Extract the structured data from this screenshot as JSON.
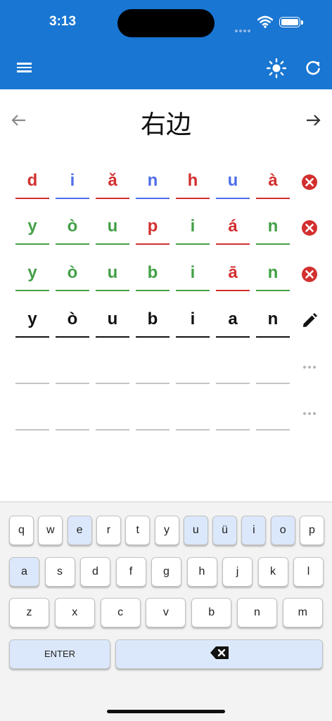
{
  "status": {
    "time": "3:13"
  },
  "header": {
    "menu_icon": "menu-icon",
    "theme_icon": "sun-icon",
    "refresh_icon": "refresh-icon"
  },
  "page": {
    "title": "右边",
    "prev_icon": "arrow-left-icon",
    "next_icon": "arrow-right-icon"
  },
  "colors": {
    "correct": "#43a047",
    "wrong": "#d32f2f",
    "misplaced": "#4f6ee8",
    "pending": "#111111",
    "empty": "#c4c4c4",
    "accent": "#1976d2",
    "key_highlight": "#dbe8fb"
  },
  "guesses": [
    {
      "status": "wrong",
      "letters": [
        {
          "char": "d",
          "state": "wrong"
        },
        {
          "char": "i",
          "state": "misplaced"
        },
        {
          "char": "ǎ",
          "state": "wrong"
        },
        {
          "char": "n",
          "state": "misplaced"
        },
        {
          "char": "h",
          "state": "wrong"
        },
        {
          "char": "u",
          "state": "misplaced"
        },
        {
          "char": "à",
          "state": "wrong"
        }
      ]
    },
    {
      "status": "wrong",
      "letters": [
        {
          "char": "y",
          "state": "correct"
        },
        {
          "char": "ò",
          "state": "correct"
        },
        {
          "char": "u",
          "state": "correct"
        },
        {
          "char": "p",
          "state": "wrong"
        },
        {
          "char": "i",
          "state": "correct"
        },
        {
          "char": "á",
          "state": "wrong"
        },
        {
          "char": "n",
          "state": "correct"
        }
      ]
    },
    {
      "status": "wrong",
      "letters": [
        {
          "char": "y",
          "state": "correct"
        },
        {
          "char": "ò",
          "state": "correct"
        },
        {
          "char": "u",
          "state": "correct"
        },
        {
          "char": "b",
          "state": "correct"
        },
        {
          "char": "i",
          "state": "correct"
        },
        {
          "char": "ā",
          "state": "wrong"
        },
        {
          "char": "n",
          "state": "correct"
        }
      ]
    },
    {
      "status": "editing",
      "letters": [
        {
          "char": "y",
          "state": "pending"
        },
        {
          "char": "ò",
          "state": "pending"
        },
        {
          "char": "u",
          "state": "pending"
        },
        {
          "char": "b",
          "state": "pending"
        },
        {
          "char": "i",
          "state": "pending"
        },
        {
          "char": "a",
          "state": "pending"
        },
        {
          "char": "n",
          "state": "pending"
        }
      ]
    },
    {
      "status": "empty",
      "letters": [
        {
          "char": "",
          "state": "empty"
        },
        {
          "char": "",
          "state": "empty"
        },
        {
          "char": "",
          "state": "empty"
        },
        {
          "char": "",
          "state": "empty"
        },
        {
          "char": "",
          "state": "empty"
        },
        {
          "char": "",
          "state": "empty"
        },
        {
          "char": "",
          "state": "empty"
        }
      ]
    },
    {
      "status": "empty",
      "letters": [
        {
          "char": "",
          "state": "empty"
        },
        {
          "char": "",
          "state": "empty"
        },
        {
          "char": "",
          "state": "empty"
        },
        {
          "char": "",
          "state": "empty"
        },
        {
          "char": "",
          "state": "empty"
        },
        {
          "char": "",
          "state": "empty"
        },
        {
          "char": "",
          "state": "empty"
        }
      ]
    }
  ],
  "keyboard": {
    "row1": [
      {
        "label": "q",
        "hl": false
      },
      {
        "label": "w",
        "hl": false
      },
      {
        "label": "e",
        "hl": true
      },
      {
        "label": "r",
        "hl": false
      },
      {
        "label": "t",
        "hl": false
      },
      {
        "label": "y",
        "hl": false
      },
      {
        "label": "u",
        "hl": true
      },
      {
        "label": "ü",
        "hl": true
      },
      {
        "label": "i",
        "hl": true
      },
      {
        "label": "o",
        "hl": true
      },
      {
        "label": "p",
        "hl": false
      }
    ],
    "row2": [
      {
        "label": "a",
        "hl": true
      },
      {
        "label": "s",
        "hl": false
      },
      {
        "label": "d",
        "hl": false
      },
      {
        "label": "f",
        "hl": false
      },
      {
        "label": "g",
        "hl": false
      },
      {
        "label": "h",
        "hl": false
      },
      {
        "label": "j",
        "hl": false
      },
      {
        "label": "k",
        "hl": false
      },
      {
        "label": "l",
        "hl": false
      }
    ],
    "row3": [
      {
        "label": "z",
        "hl": false
      },
      {
        "label": "x",
        "hl": false
      },
      {
        "label": "c",
        "hl": false
      },
      {
        "label": "v",
        "hl": false
      },
      {
        "label": "b",
        "hl": false
      },
      {
        "label": "n",
        "hl": false
      },
      {
        "label": "m",
        "hl": false
      }
    ],
    "enter_label": "ENTER",
    "backspace_icon": "backspace-icon"
  }
}
